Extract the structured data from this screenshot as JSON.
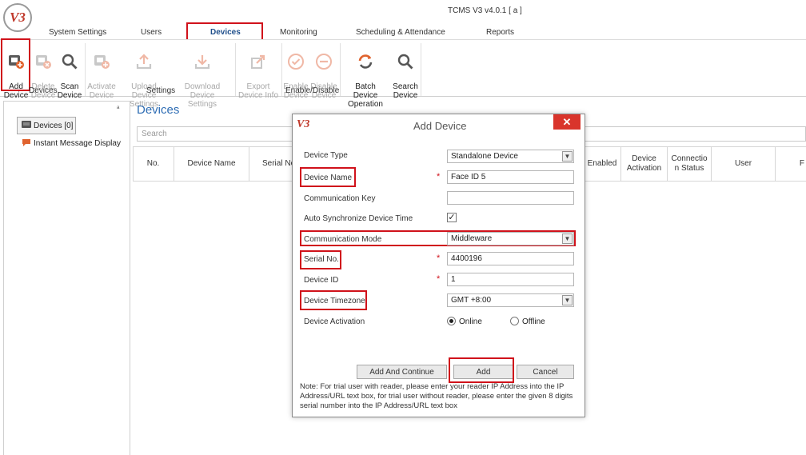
{
  "app": {
    "logo_text": "V3",
    "title": "TCMS V3 v4.0.1 [ a ]"
  },
  "menu": {
    "tabs": [
      {
        "label": "System Settings"
      },
      {
        "label": "Users"
      },
      {
        "label": "Devices"
      },
      {
        "label": "Monitoring"
      },
      {
        "label": "Scheduling & Attendance"
      },
      {
        "label": "Reports"
      }
    ],
    "active_tab": "Devices"
  },
  "ribbon": {
    "buttons": {
      "add_device": "Add\nDevice",
      "delete_device": "Delete\nDevice",
      "scan_device": "Scan\nDevice",
      "activate_device": "Activate\nDevice",
      "upload_settings": "Upload Device\nSettings",
      "download_settings": "Download Device\nSettings",
      "export_info": "Export\nDevice Info",
      "enable_device": "Enable\nDevice",
      "disable_device": "Disable\nDevice",
      "batch_operation": "Batch Device\nOperation",
      "search_device": "Search\nDevice"
    },
    "groups": {
      "devices": "Devices",
      "settings": "Settings",
      "enable_disable": "Enable/Disable"
    }
  },
  "sidebar": {
    "pin": "ᵃ",
    "devices_item": "Devices [0]",
    "message_item": "Instant Message Display"
  },
  "main": {
    "title": "Devices",
    "search_placeholder": "Search",
    "columns": {
      "no": "No.",
      "device_name": "Device Name",
      "serial_no": "Serial No",
      "enabled": "Enabled",
      "activation": "Device\nActivation",
      "connection": "Connectio\nn Status",
      "user": "User",
      "f": "F"
    }
  },
  "dialog": {
    "logo": "V3",
    "title": "Add Device",
    "close": "✕",
    "fields": {
      "device_type_label": "Device Type",
      "device_type_value": "Standalone Device",
      "device_name_label": "Device Name",
      "device_name_value": "Face ID 5",
      "comm_key_label": "Communication Key",
      "comm_key_value": "",
      "auto_sync_label": "Auto Synchronize Device Time",
      "auto_sync_checked": "✓",
      "comm_mode_label": "Communication Mode",
      "comm_mode_value": "Middleware",
      "serial_label": "Serial No.",
      "serial_value": "4400196",
      "device_id_label": "Device ID",
      "device_id_value": "1",
      "timezone_label": "Device Timezone",
      "timezone_value": "GMT +8:00",
      "activation_label": "Device Activation",
      "online": "Online",
      "offline": "Offline"
    },
    "required_mark": "*",
    "buttons": {
      "add_continue": "Add And Continue",
      "add": "Add",
      "cancel": "Cancel"
    },
    "note": "Note: For trial user with reader, please enter your reader IP Address into the IP Address/URL text box, for trial user without reader, please enter the given 8 digits serial number into the IP Address/URL text box"
  },
  "colors": {
    "accent": "#2e6db4",
    "highlight": "#d0121b",
    "close": "#d9342b"
  }
}
